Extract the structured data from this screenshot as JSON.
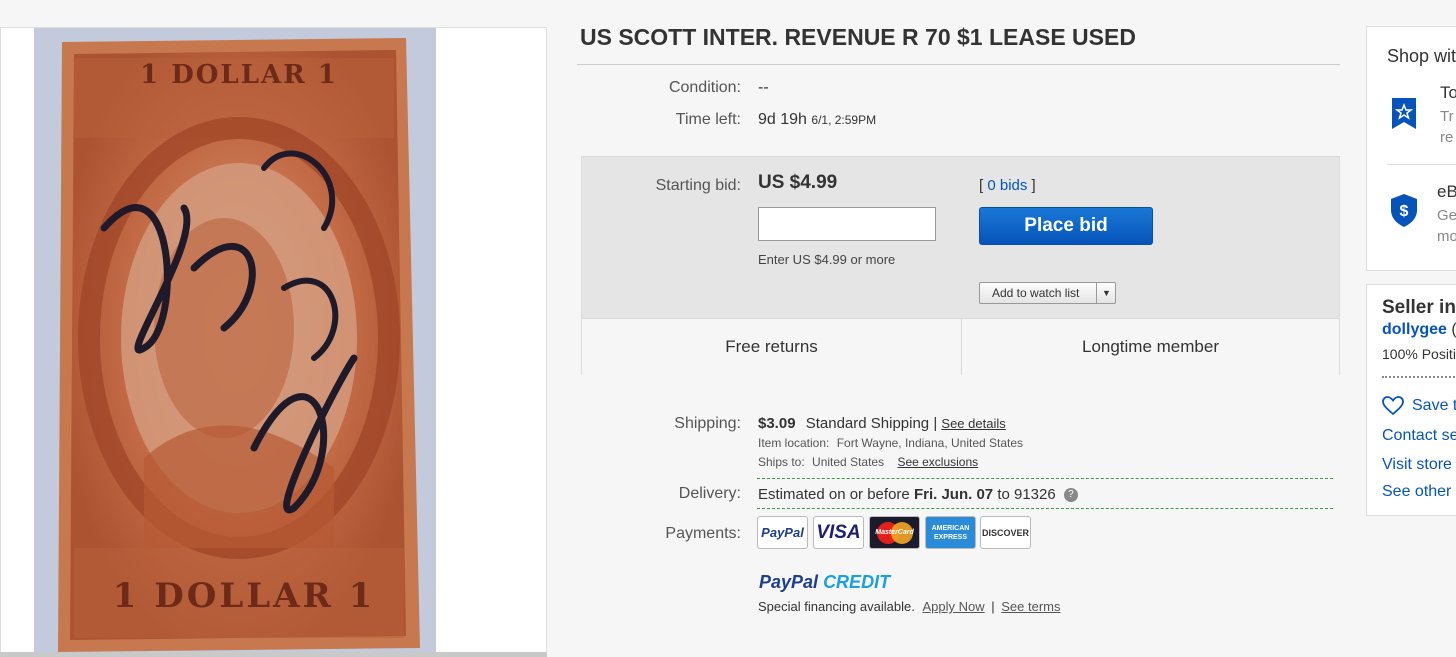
{
  "item": {
    "title": "US SCOTT INTER. REVENUE R 70 $1 LEASE USED"
  },
  "stamp": {
    "top_text": "1 DOLLAR 1",
    "bottom_text": "1 DOLLAR 1"
  },
  "details": {
    "condition_label": "Condition:",
    "condition_value": "--",
    "time_left_label": "Time left:",
    "time_left_value": "9d 19h",
    "time_left_end": "6/1, 2:59PM"
  },
  "bid": {
    "starting_bid_label": "Starting bid:",
    "starting_bid_value": "US $4.99",
    "bids_open": "[",
    "bids_count": "0 bids",
    "bids_close": "]",
    "input_value": "",
    "input_hint": "Enter US $4.99 or more",
    "place_bid_label": "Place bid",
    "watch_label": "Add to watch list",
    "features": [
      "Free returns",
      "Longtime member"
    ]
  },
  "shipping": {
    "label": "Shipping:",
    "cost": "$3.09",
    "method": "Standard Shipping",
    "separator": "|",
    "details_link": "See details",
    "location_label": "Item location:",
    "location_value": "Fort Wayne, Indiana, United States",
    "ships_to_label": "Ships to:",
    "ships_to_value": "United States",
    "exclusions_link": "See exclusions"
  },
  "delivery": {
    "label": "Delivery:",
    "prefix": "Estimated on or before",
    "date": "Fri. Jun. 07",
    "to": "to",
    "zip": "91326",
    "help_icon": "?"
  },
  "payments": {
    "label": "Payments:",
    "logos": [
      "PayPal",
      "VISA",
      "MasterCard",
      "AMERICAN EXPRESS",
      "DISCOVER"
    ],
    "paypal_credit_a": "PayPal",
    "paypal_credit_b": "CREDIT",
    "financing_text": "Special financing available.",
    "apply_link": "Apply Now",
    "separator": "|",
    "terms_link": "See terms"
  },
  "shop_with_confidence": {
    "title": "Shop wit",
    "item1_title": "To",
    "item1_line1": "Tr",
    "item1_line2": "re",
    "item2_title": "eB",
    "item2_line1": "Ge",
    "item2_line2": "mo"
  },
  "seller": {
    "title": "Seller in",
    "name": "dollygee",
    "name_suffix": "(",
    "feedback": "100% Positi",
    "save_label": "Save t",
    "contact": "Contact se",
    "visit_store": "Visit store",
    "see_other": "See other"
  },
  "colors": {
    "accent_blue": "#0654ba",
    "bid_box_bg": "#e5e5e5",
    "dashed_green": "#3a9a4a"
  }
}
